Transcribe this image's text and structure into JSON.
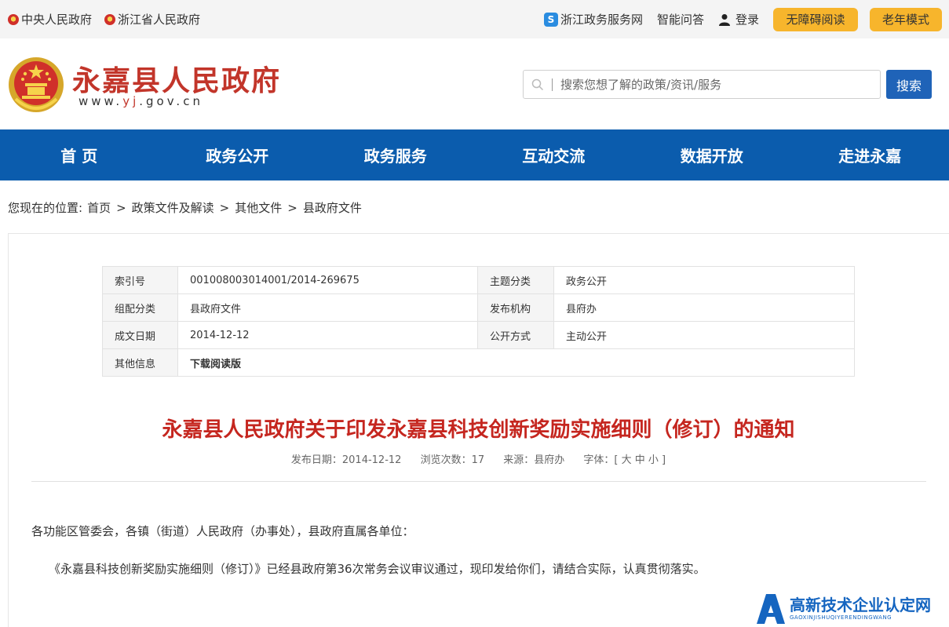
{
  "topbar": {
    "links_left": [
      "中央人民政府",
      "浙江省人民政府"
    ],
    "service_link": "浙江政务服务网",
    "qa_link": "智能问答",
    "login": "登录",
    "accessible": "无障碍阅读",
    "elderly": "老年模式"
  },
  "header": {
    "title": "永嘉县人民政府",
    "url_pre": "www.",
    "url_hl": "yj",
    "url_post": ".gov.cn",
    "search_placeholder": "搜索您想了解的政策/资讯/服务",
    "search_button": "搜索"
  },
  "nav": [
    "首 页",
    "政务公开",
    "政务服务",
    "互动交流",
    "数据开放",
    "走进永嘉"
  ],
  "breadcrumb": {
    "label": "您现在的位置:",
    "items": [
      "首页",
      "政策文件及解读",
      "其他文件",
      "县政府文件"
    ],
    "sep": ">"
  },
  "meta": {
    "index_k": "索引号",
    "index_v": "001008003014001/2014-269675",
    "topic_k": "主题分类",
    "topic_v": "政务公开",
    "group_k": "组配分类",
    "group_v": "县政府文件",
    "org_k": "发布机构",
    "org_v": "县府办",
    "date_k": "成文日期",
    "date_v": "2014-12-12",
    "mode_k": "公开方式",
    "mode_v": "主动公开",
    "other_k": "其他信息",
    "other_v": "下载阅读版"
  },
  "doc": {
    "title": "永嘉县人民政府关于印发永嘉县科技创新奖励实施细则（修订）的通知",
    "publish": "发布日期：2014-12-12",
    "views": "浏览次数：17",
    "source": "来源：县府办",
    "font": "字体：[ 大 中 小 ]",
    "para1": "各功能区管委会，各镇（街道）人民政府（办事处），县政府直属各单位：",
    "para2": "《永嘉县科技创新奖励实施细则（修订）》已经县政府第36次常务会议审议通过，现印发给你们，请结合实际，认真贯彻落实。"
  },
  "watermark": {
    "main": "高新技术企业认定网",
    "sub": "GAOXINJISHUQIYERENDINGWANG"
  },
  "colors": {
    "nav_bg": "#0b5cad",
    "title_red": "#c5261f",
    "pill": "#f7b52c",
    "button_blue": "#1f63b8"
  }
}
